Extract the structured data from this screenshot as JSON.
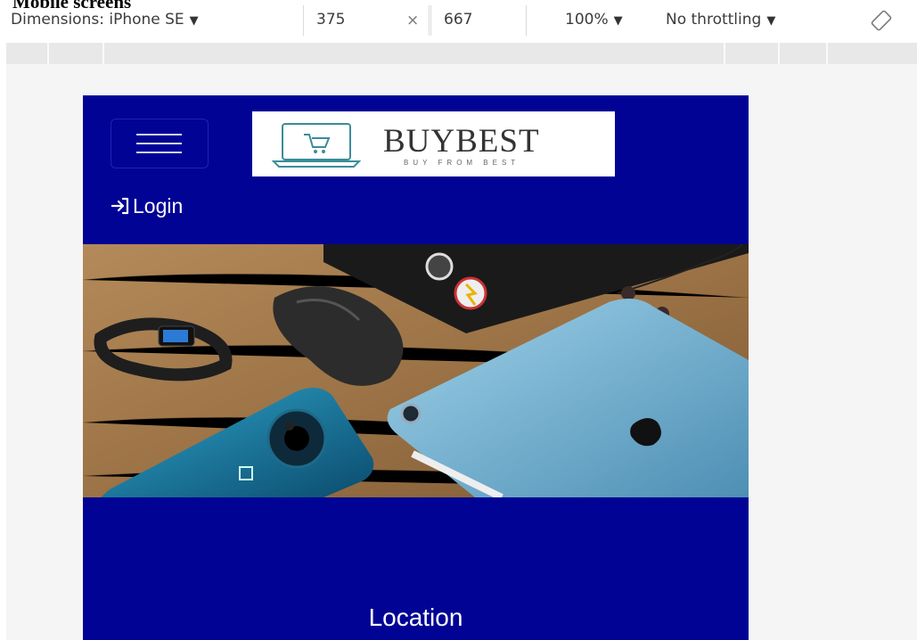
{
  "page": {
    "heading": "Mobile screens"
  },
  "devtools": {
    "dimensions_label": "Dimensions: iPhone SE",
    "width_value": "375",
    "times_symbol": "×",
    "height_value": "667",
    "zoom_label": "100%",
    "throttling_label": "No throttling",
    "dropdown_caret": "▼"
  },
  "site": {
    "logo_title": "BUYBEST",
    "logo_tagline": "BUY FROM BEST",
    "login_label": "Login",
    "location_heading": "Location"
  },
  "colors": {
    "header_blue": "#000394",
    "viewport_bg": "#f5f5f5",
    "logo_teal": "#3b8c9a"
  },
  "icons": {
    "menu": "hamburger-icon",
    "login": "login-arrow-icon",
    "rotate": "rotate-device-icon",
    "cart": "laptop-cart-icon"
  }
}
